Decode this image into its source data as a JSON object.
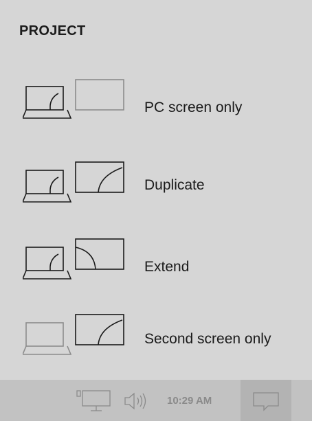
{
  "panel": {
    "title": "PROJECT",
    "options": [
      {
        "label": "PC screen only",
        "icon": "pc-screen-only-icon"
      },
      {
        "label": "Duplicate",
        "icon": "duplicate-icon"
      },
      {
        "label": "Extend",
        "icon": "extend-icon"
      },
      {
        "label": "Second screen only",
        "icon": "second-screen-only-icon"
      }
    ]
  },
  "taskbar": {
    "time": "10:29 AM",
    "icons": [
      "display-icon",
      "volume-icon",
      "action-center-icon"
    ]
  },
  "colors": {
    "background": "#d6d6d6",
    "taskbar": "#c2c2c2",
    "taskbar_active": "#b3b3b3",
    "line": "#1a1a1a",
    "muted_line": "#8c8c8c"
  }
}
